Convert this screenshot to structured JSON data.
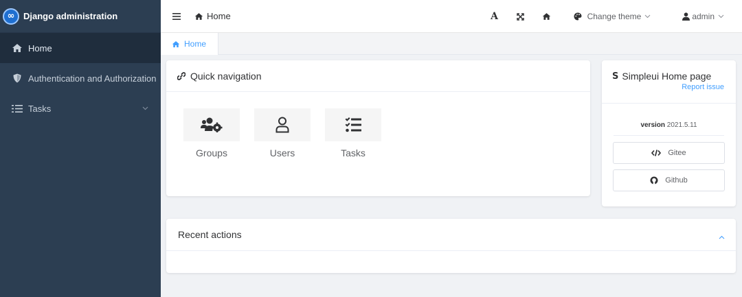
{
  "brand": {
    "title": "Django administration"
  },
  "sidebar": {
    "items": [
      {
        "label": "Home",
        "icon": "home-icon"
      },
      {
        "label": "Authentication and Authorization",
        "icon": "shield-icon"
      },
      {
        "label": "Tasks",
        "icon": "list-icon"
      }
    ]
  },
  "topbar": {
    "breadcrumb": "Home",
    "font_icon_label": "A",
    "theme_label": "Change theme",
    "user_label": "admin"
  },
  "tabs": [
    {
      "label": "Home"
    }
  ],
  "quick_nav": {
    "title": "Quick navigation",
    "items": [
      {
        "label": "Groups",
        "icon": "users-cog-icon"
      },
      {
        "label": "Users",
        "icon": "user-icon"
      },
      {
        "label": "Tasks",
        "icon": "tasks-icon"
      }
    ]
  },
  "simpleui": {
    "brand_letter": "S",
    "title": "Simpleui Home page",
    "report": "Report issue",
    "version_label": "version",
    "version_value": "2021.5.11",
    "gitee_label": "Gitee",
    "github_label": "Github"
  },
  "recent": {
    "title": "Recent actions"
  },
  "colors": {
    "sidebar_bg": "#2c3e52",
    "accent": "#409eff"
  }
}
